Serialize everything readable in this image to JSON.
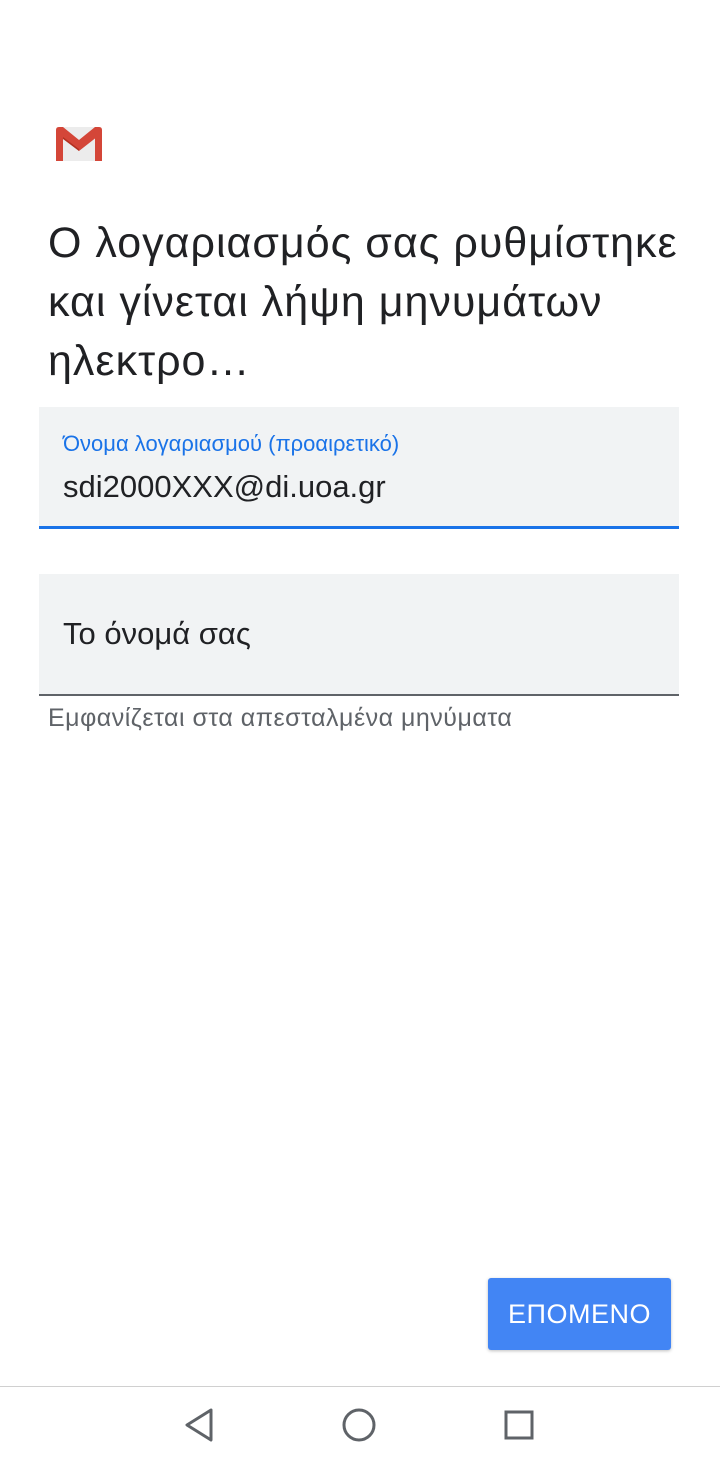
{
  "app": {
    "logo_icon": "gmail-m-icon",
    "brand_colors": {
      "red": "#d44638",
      "light_red": "#e57368",
      "gray": "#e3e3e3"
    }
  },
  "header": {
    "title": "Ο λογαριασμός σας ρυθμίστηκε και γίνεται λήψη μηνυμάτων ηλεκτρο…"
  },
  "form": {
    "account_name": {
      "label": "Όνομα λογαριασμού (προαιρετικό)",
      "value": "sdi2000XXX@di.uoa.gr"
    },
    "your_name": {
      "placeholder": "Το όνομά σας",
      "value": "",
      "helper": "Εμφανίζεται στα απεσταλμένα μηνύματα"
    }
  },
  "actions": {
    "next_label": "ΕΠΟΜΕΝΟ"
  },
  "accent_color": "#1a73e8",
  "button_color": "#4285f4",
  "navbar": {
    "back_icon": "back-triangle-icon",
    "home_icon": "home-circle-icon",
    "recents_icon": "recents-square-icon"
  }
}
